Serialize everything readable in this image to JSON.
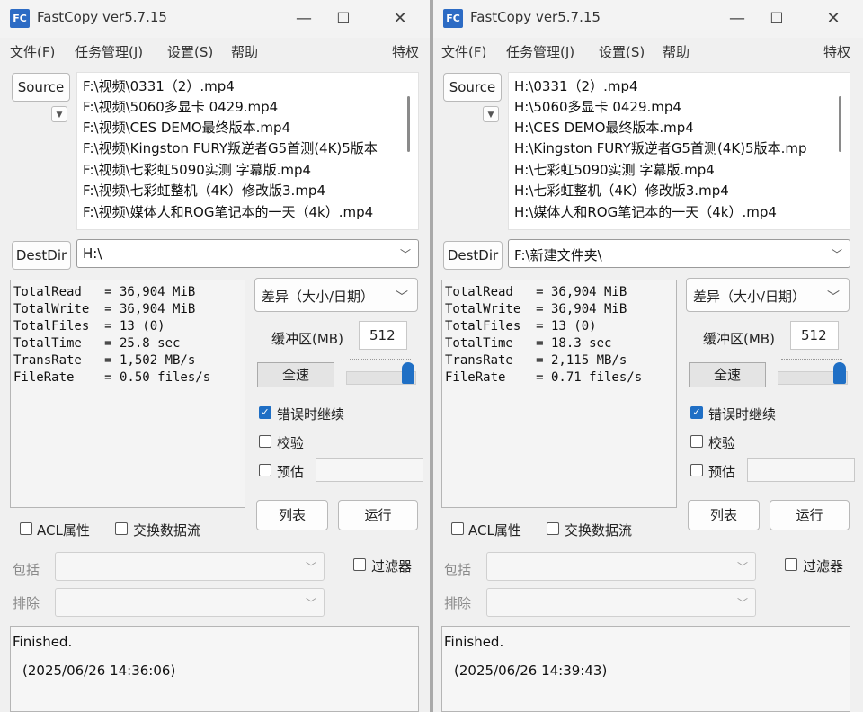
{
  "windows": [
    {
      "title": "FastCopy ver5.7.15",
      "icon_text": "FC",
      "controls": {
        "minimize": "—",
        "maximize": "☐",
        "close": "✕"
      },
      "menu": [
        "文件(F)",
        "任务管理(J)",
        "设置(S)",
        "帮助",
        "特权"
      ],
      "source_button": "Source",
      "source_files": [
        "F:\\视频\\0331（2）.mp4",
        "F:\\视频\\5060多显卡  0429.mp4",
        "F:\\视频\\CES DEMO最终版本.mp4",
        "F:\\视频\\Kingston FURY叛逆者G5首测(4K)5版本",
        "F:\\视频\\七彩虹5090实测 字幕版.mp4",
        "F:\\视频\\七彩虹整机（4K）修改版3.mp4",
        "F:\\视频\\媒体人和ROG笔记本的一天（4k）.mp4"
      ],
      "dest_button": "DestDir",
      "dest_value": "H:\\",
      "stats": [
        "TotalRead   = 36,904 MiB",
        "TotalWrite  = 36,904 MiB",
        "TotalFiles  = 13 (0)",
        "TotalTime   = 25.8 sec",
        "TransRate   = 1,502 MB/s",
        "FileRate    = 0.50 files/s"
      ],
      "mode": "差异（大小/日期）",
      "buffer_label": "缓冲区(MB)",
      "buffer_value": "512",
      "speed_button": "全速",
      "speed_level": 1.0,
      "continue_on_error": "错误时继续",
      "continue_on_error_checked": true,
      "verify": "校验",
      "verify_checked": false,
      "estimate": "预估",
      "estimate_checked": false,
      "list_button": "列表",
      "run_button": "运行",
      "acl": "ACL属性",
      "ads": "交换数据流",
      "filter": "过滤器",
      "include_label": "包括",
      "exclude_label": "排除",
      "status_line1": "Finished.",
      "status_line2": "(2025/06/26 14:36:06)"
    },
    {
      "title": "FastCopy ver5.7.15",
      "icon_text": "FC",
      "controls": {
        "minimize": "—",
        "maximize": "☐",
        "close": "✕"
      },
      "menu": [
        "文件(F)",
        "任务管理(J)",
        "设置(S)",
        "帮助",
        "特权"
      ],
      "source_button": "Source",
      "source_files": [
        "H:\\0331（2）.mp4",
        "H:\\5060多显卡  0429.mp4",
        "H:\\CES DEMO最终版本.mp4",
        "H:\\Kingston FURY叛逆者G5首测(4K)5版本.mp",
        "H:\\七彩虹5090实测 字幕版.mp4",
        "H:\\七彩虹整机（4K）修改版3.mp4",
        "H:\\媒体人和ROG笔记本的一天（4k）.mp4"
      ],
      "dest_button": "DestDir",
      "dest_value": "F:\\新建文件夹\\",
      "stats": [
        "TotalRead   = 36,904 MiB",
        "TotalWrite  = 36,904 MiB",
        "TotalFiles  = 13 (0)",
        "TotalTime   = 18.3 sec",
        "TransRate   = 2,115 MB/s",
        "FileRate    = 0.71 files/s"
      ],
      "mode": "差异（大小/日期）",
      "buffer_label": "缓冲区(MB)",
      "buffer_value": "512",
      "speed_button": "全速",
      "speed_level": 1.0,
      "continue_on_error": "错误时继续",
      "continue_on_error_checked": true,
      "verify": "校验",
      "verify_checked": false,
      "estimate": "预估",
      "estimate_checked": false,
      "list_button": "列表",
      "run_button": "运行",
      "acl": "ACL属性",
      "ads": "交换数据流",
      "filter": "过滤器",
      "include_label": "包括",
      "exclude_label": "排除",
      "status_line1": "Finished.",
      "status_line2": "(2025/06/26 14:39:43)"
    }
  ],
  "colors": {
    "accent": "#1f6fc5",
    "window_bg": "#f0f0f0"
  }
}
